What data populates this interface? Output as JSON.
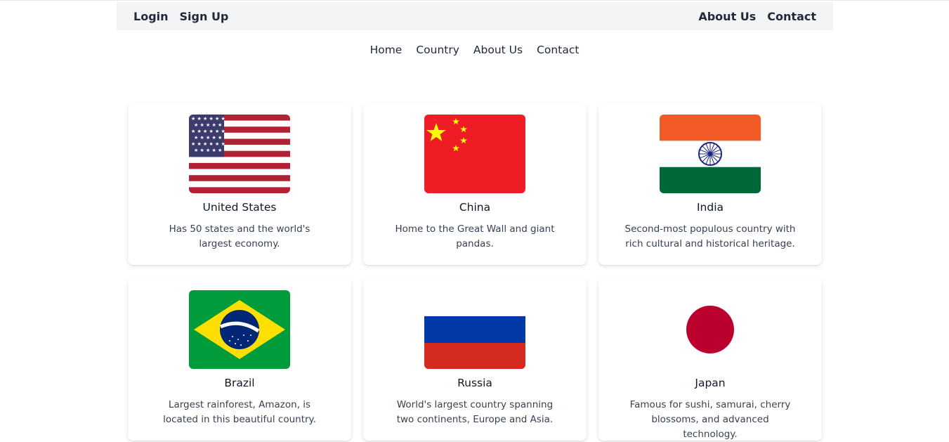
{
  "topbar": {
    "left_links": [
      "Login",
      "Sign Up"
    ],
    "right_links": [
      "About Us",
      "Contact"
    ]
  },
  "nav": [
    "Home",
    "Country",
    "About Us",
    "Contact"
  ],
  "countries": [
    {
      "name": "United States",
      "description": "Has 50 states and the world's largest economy.",
      "flag": "us-flag"
    },
    {
      "name": "China",
      "description": "Home to the Great Wall and giant pandas.",
      "flag": "china-flag"
    },
    {
      "name": "India",
      "description": "Second-most populous country with rich cultural and historical heritage.",
      "flag": "india-flag"
    },
    {
      "name": "Brazil",
      "description": "Largest rainforest, Amazon, is located in this beautiful country.",
      "flag": "brazil-flag"
    },
    {
      "name": "Russia",
      "description": "World's largest country spanning two continents, Europe and Asia.",
      "flag": "russia-flag"
    },
    {
      "name": "Japan",
      "description": "Famous for sushi, samurai, cherry blossoms, and advanced technology.",
      "flag": "japan-flag"
    }
  ],
  "colors": {
    "topbar_bg": "#f3f4f6",
    "nav_text": "#1f2937",
    "card_text": "#374151"
  }
}
